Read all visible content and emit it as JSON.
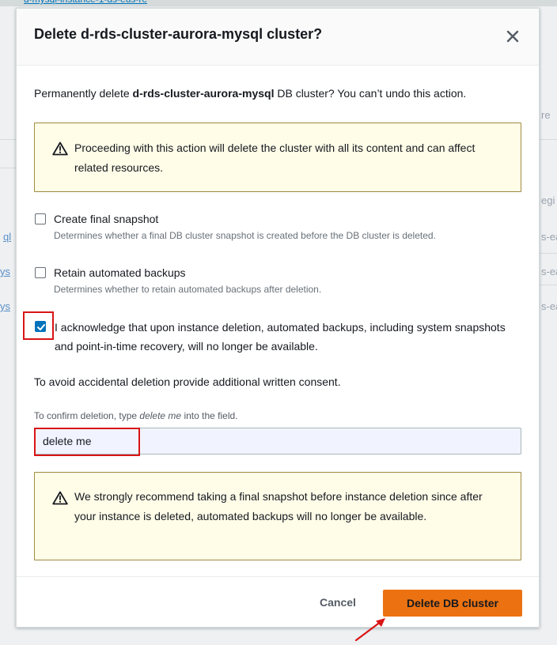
{
  "background": {
    "breadcrumb": "d-mysql-instance-1-ds-eus-re",
    "frag_right_top": "re",
    "frag_right_region": "egi",
    "frag_right_row1": "s-ea",
    "frag_right_row2": "s-ea",
    "frag_right_row3": "s-ea",
    "frag_left_row1": "ql",
    "frag_left_row2": "ys",
    "frag_left_row3": "ys"
  },
  "modal": {
    "title": "Delete d-rds-cluster-aurora-mysql cluster?",
    "close_icon": "close-icon",
    "intro_prefix": "Permanently delete ",
    "intro_cluster": "d-rds-cluster-aurora-mysql",
    "intro_suffix": " DB cluster? You can’t undo this action.",
    "alert_top": {
      "icon": "warning-icon",
      "text": "Proceeding with this action will delete the cluster with all its content and can affect related resources."
    },
    "options": [
      {
        "label": "Create final snapshot",
        "description": "Determines whether a final DB cluster snapshot is created before the DB cluster is deleted.",
        "checked": false
      },
      {
        "label": "Retain automated backups",
        "description": "Determines whether to retain automated backups after deletion.",
        "checked": false
      }
    ],
    "acknowledge": {
      "label": "I acknowledge that upon instance deletion, automated backups, including system snapshots and point-in-time recovery, will no longer be available.",
      "checked": true
    },
    "consent_text": "To avoid accidental deletion provide additional written consent.",
    "confirm_label_prefix": "To confirm deletion, type ",
    "confirm_label_phrase": "delete me",
    "confirm_label_suffix": " into the field.",
    "confirm_input_value": "delete me",
    "alert_bottom": {
      "icon": "warning-icon",
      "text": "We strongly recommend taking a final snapshot before instance deletion since after your instance is deleted, automated backups will no longer be available."
    },
    "footer": {
      "cancel_label": "Cancel",
      "delete_label": "Delete DB cluster"
    }
  },
  "colors": {
    "primary_button": "#ec7211",
    "warning_border": "#a08a42",
    "warning_bg": "#fffce8",
    "checkbox_checked": "#0073bb",
    "annotation_red": "#d91515"
  }
}
